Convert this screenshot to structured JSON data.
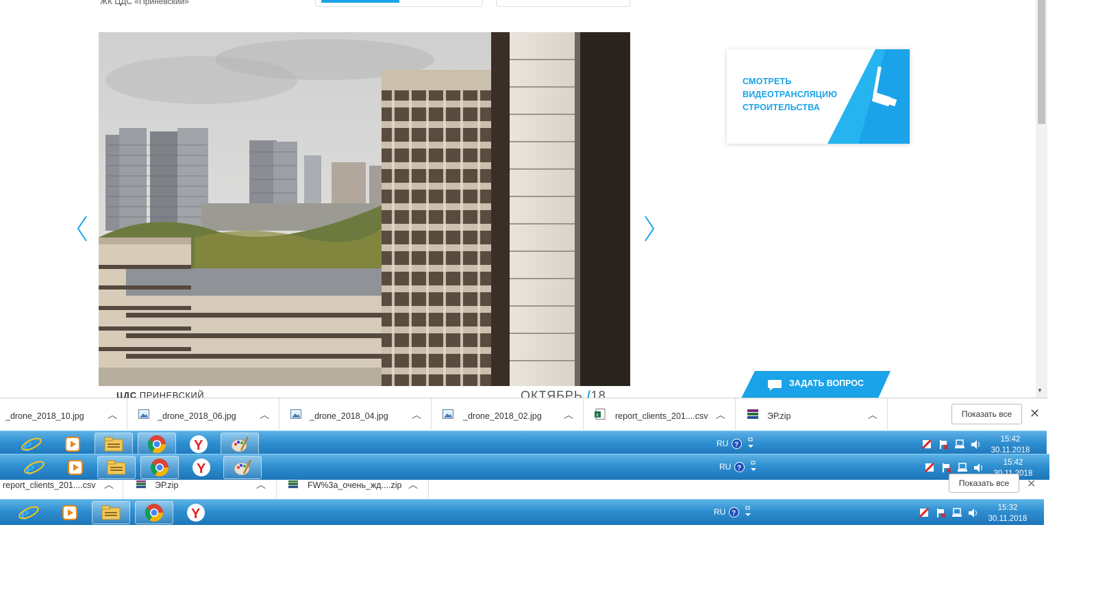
{
  "site": {
    "name": "ЖК ЦДС «Приневский»"
  },
  "slider": {
    "caption_brand": "ЦДС",
    "caption_project": "ПРИНЕВСКИЙ",
    "caption_month": "ОКТЯБРЬ",
    "caption_year": "18"
  },
  "stream_card": {
    "line1": "СМОТРЕТЬ",
    "line2": "ВИДЕОТРАНСЛЯЦИЮ",
    "line3": "СТРОИТЕЛЬСТВА",
    "accent": "#1aa3e8"
  },
  "ask_button": {
    "label": "ЗАДАТЬ ВОПРОС",
    "color": "#1aa3e8"
  },
  "downloads": {
    "items": [
      {
        "name": "_drone_2018_10.jpg",
        "icon": "image-file-icon"
      },
      {
        "name": "_drone_2018_06.jpg",
        "icon": "image-file-icon"
      },
      {
        "name": "_drone_2018_04.jpg",
        "icon": "image-file-icon"
      },
      {
        "name": "_drone_2018_02.jpg",
        "icon": "image-file-icon"
      },
      {
        "name": "report_clients_201....csv",
        "icon": "csv-file-icon"
      },
      {
        "name": "ЭР.zip",
        "icon": "zip-archive-icon"
      }
    ],
    "show_all": "Показать все"
  },
  "taskbar_top": {
    "lang": "RU",
    "time": "15:42",
    "date": "30.11.2018"
  },
  "taskbar_mid": {
    "lang": "RU",
    "time": "15:42",
    "date": "30.11.2018"
  },
  "downloads_lower": {
    "items": [
      {
        "name": "report_clients_201....csv"
      },
      {
        "name": "ЭР.zip"
      },
      {
        "name": "FW%3a_очень_жд....zip"
      }
    ],
    "show_all": "Показать все"
  },
  "taskbar_bottom": {
    "lang": "RU",
    "time": "15:32",
    "date": "30.11.2018"
  }
}
